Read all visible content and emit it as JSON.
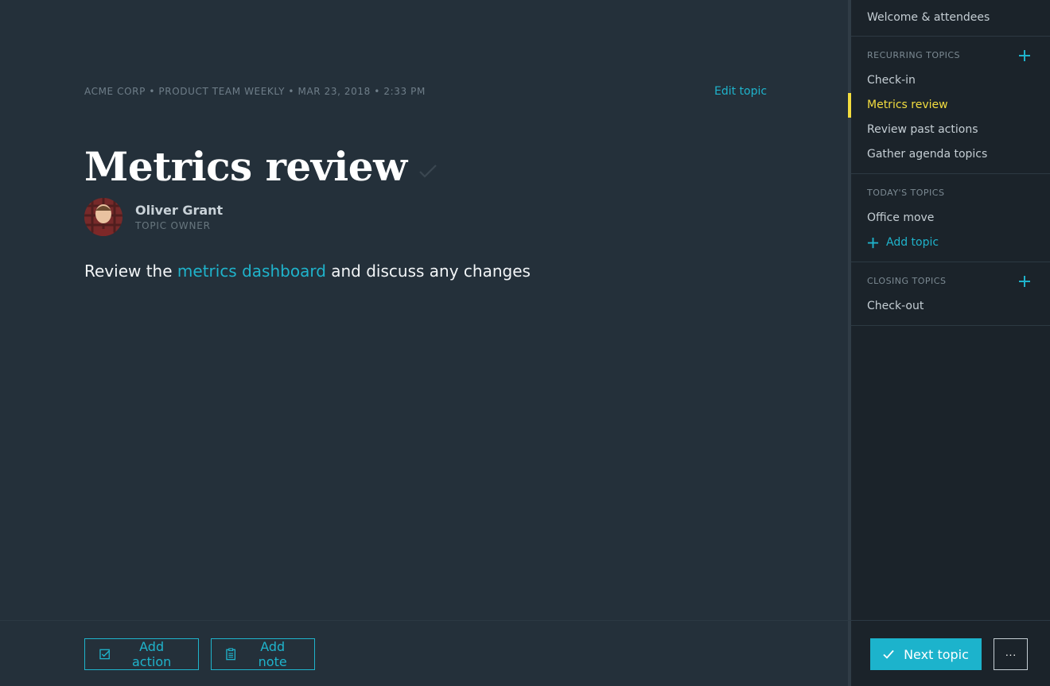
{
  "main": {
    "breadcrumb": "ACME CORP • PRODUCT TEAM WEEKLY • MAR 23, 2018 • 2:33 PM",
    "edit_topic_label": "Edit topic",
    "title": "Metrics review",
    "owner": {
      "name": "Oliver Grant",
      "role": "TOPIC OWNER"
    },
    "description": {
      "before": "Review the ",
      "link": "metrics dashboard",
      "after": " and discuss any changes"
    },
    "footer": {
      "add_action_label": "Add action",
      "add_note_label": "Add note"
    }
  },
  "sidebar": {
    "welcome": "Welcome & attendees",
    "recurring": {
      "heading": "RECURRING TOPICS",
      "items": [
        "Check-in",
        "Metrics review",
        "Review past actions",
        "Gather agenda topics"
      ],
      "active": "Metrics review"
    },
    "today": {
      "heading": "TODAY'S TOPICS",
      "items": [
        "Office move"
      ],
      "add_label": "Add topic"
    },
    "closing": {
      "heading": "CLOSING TOPICS",
      "items": [
        "Check-out"
      ]
    },
    "footer": {
      "next_label": "Next topic",
      "more_label": "···"
    }
  },
  "colors": {
    "accent": "#1fb3cb",
    "active": "#f3dd3f",
    "background": "#24303a",
    "sidebar": "#1b232a"
  },
  "icons": [
    "check-icon",
    "checkbox-icon",
    "clipboard-icon",
    "plus-icon",
    "more-icon"
  ]
}
